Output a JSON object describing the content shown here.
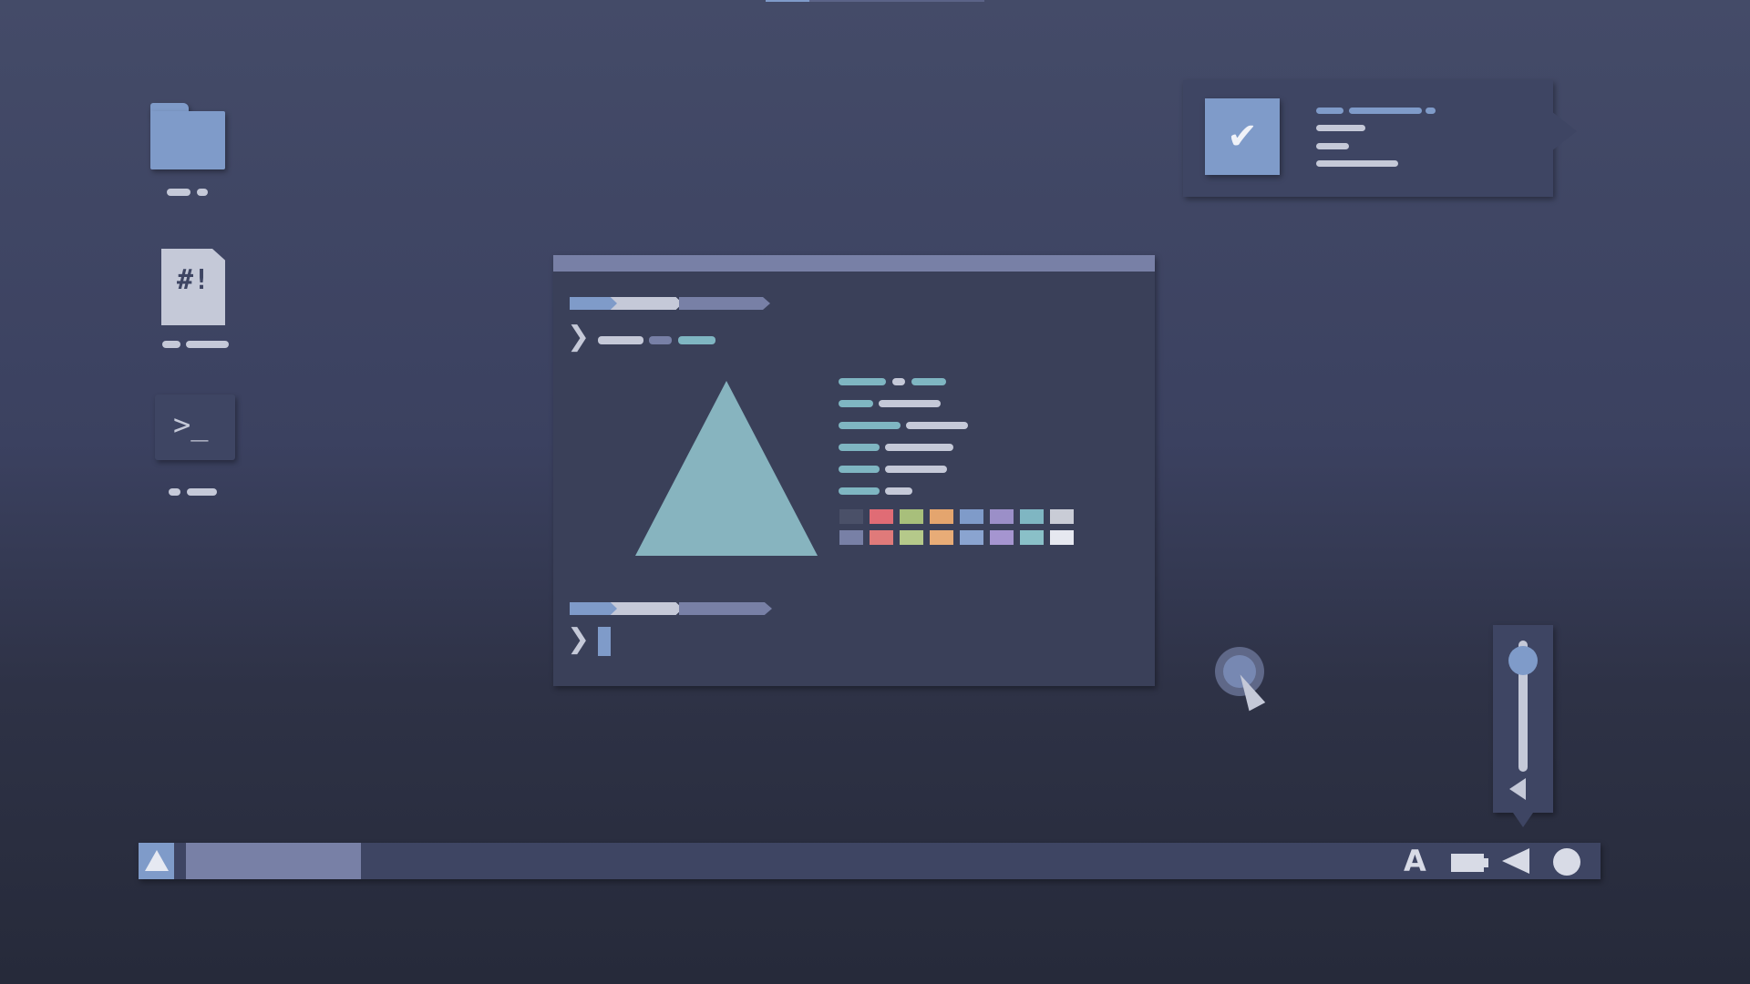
{
  "desktop": {
    "icons": [
      {
        "name": "folder",
        "glyph": ""
      },
      {
        "name": "script-file",
        "glyph": "#!"
      },
      {
        "name": "terminal",
        "glyph": ">_"
      }
    ]
  },
  "notification": {
    "check_glyph": "✔"
  },
  "terminal_window": {
    "prompt_glyph": "❯",
    "palette_row1": [
      "#4a5068",
      "#e06c75",
      "#a8bf7b",
      "#e4a56e",
      "#7f9bc9",
      "#9b8fc8",
      "#7fb6c2",
      "#c9ccd6"
    ],
    "palette_row2": [
      "#7880a6",
      "#e07a7a",
      "#b5c98a",
      "#e8ac77",
      "#8aa4d0",
      "#a595d0",
      "#8ac0c8",
      "#e6e8f0"
    ]
  },
  "volume": {
    "level": 0.85
  },
  "taskbar": {
    "start_icon": "triangle-icon",
    "tray": {
      "keyboard_layout_glyph": "A"
    }
  },
  "colors": {
    "accent_blue": "#7f9bc9",
    "teal": "#7fb6c2",
    "slate": "#7880a6",
    "panel": "#3e4563",
    "text_light": "#c5c9d8"
  }
}
